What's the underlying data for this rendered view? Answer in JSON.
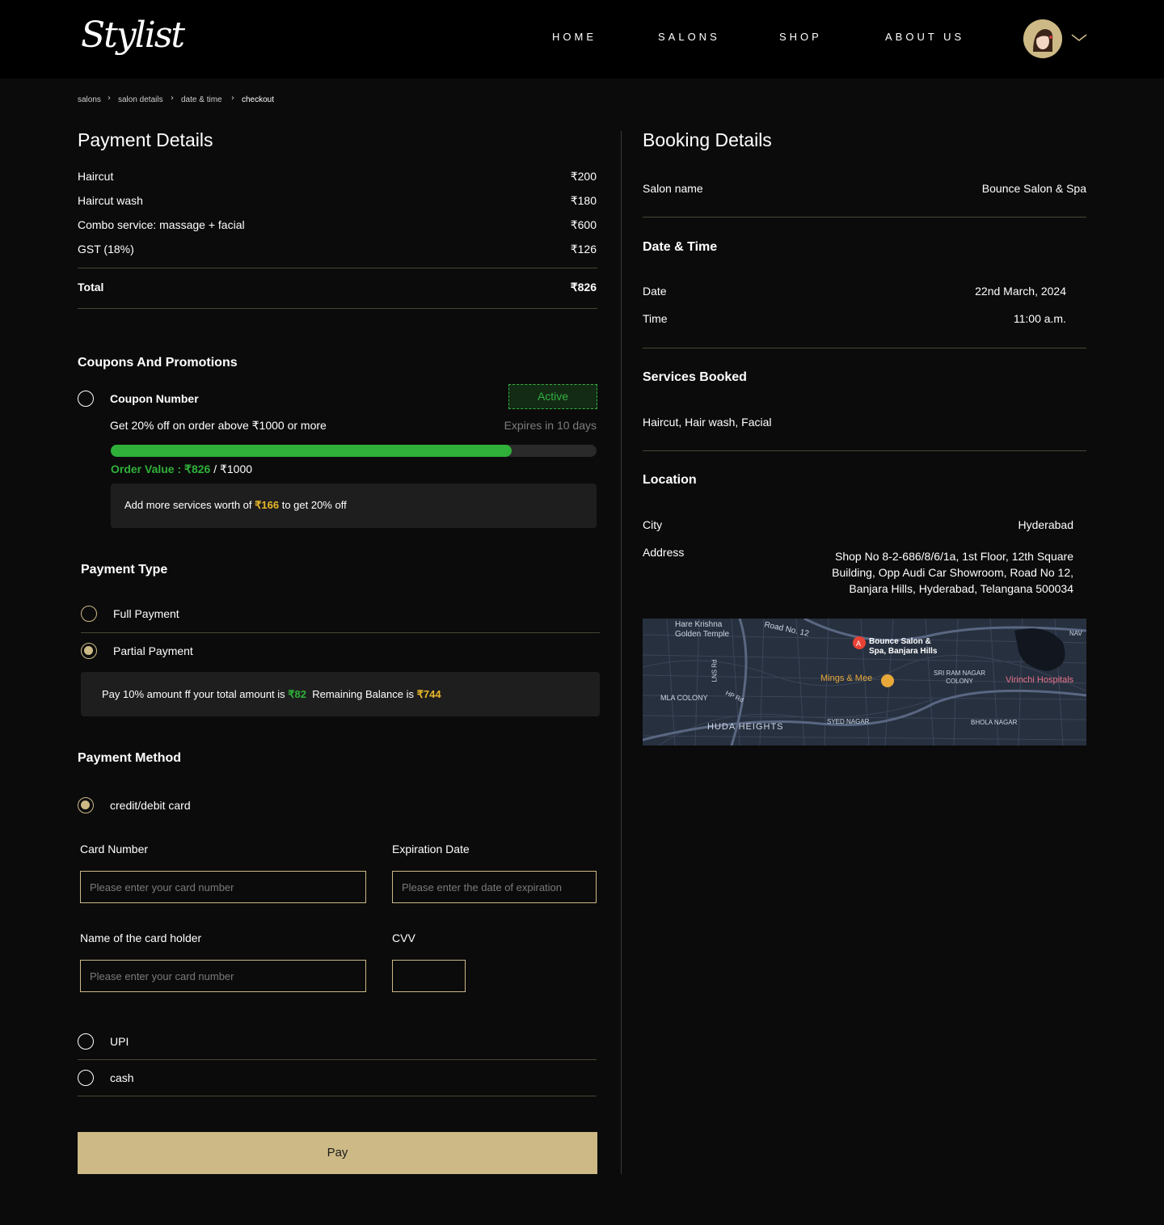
{
  "header": {
    "logo_text": "Stylist",
    "nav": [
      "HOME",
      "SALONS",
      "SHOP",
      "ABOUT US"
    ]
  },
  "breadcrumb": [
    "salons",
    "salon details",
    "date & time",
    "checkout"
  ],
  "payment": {
    "title": "Payment Details",
    "items": [
      {
        "label": "Haircut",
        "price": "₹200"
      },
      {
        "label": "Haircut wash",
        "price": "₹180"
      },
      {
        "label": "Combo service: massage + facial",
        "price": "₹600"
      },
      {
        "label": "GST (18%)",
        "price": "₹126"
      }
    ],
    "total_label": "Total",
    "total_value": "₹826"
  },
  "coupons": {
    "title": "Coupons And Promotions",
    "coupon_label": "Coupon Number",
    "status": "Active",
    "description": "Get 20% off on order above ₹1000 or more",
    "expiry": "Expires in 10 days",
    "progress": 0.826,
    "order_value_label": "Order Value : ₹826",
    "order_value_target": " / ₹1000",
    "hint_prefix": "Add more services worth of ",
    "hint_amount": "₹166",
    "hint_suffix": " to get 20% off"
  },
  "payment_type": {
    "title": "Payment Type",
    "full": "Full Payment",
    "partial": "Partial Payment",
    "note_prefix": "Pay 10% amount ff your total amount is ",
    "note_amount": "₹82",
    "note_mid": "  Remaining Balance is ",
    "note_balance": "₹744"
  },
  "payment_method": {
    "title": "Payment Method",
    "card_option": "credit/debit card",
    "card_number_label": "Card Number",
    "card_number_placeholder": "Please enter your card number",
    "expiry_label": "Expiration Date",
    "expiry_placeholder": "Please enter the date of expiration",
    "holder_label": "Name of the card holder",
    "holder_placeholder": "Please enter your card number",
    "cvv_label": "CVV",
    "upi": "UPI",
    "cash": "cash",
    "pay_label": "Pay"
  },
  "booking": {
    "title": "Booking Details",
    "salon_label": "Salon name",
    "salon_value": "Bounce Salon & Spa",
    "datetime_title": "Date & Time",
    "date_label": "Date",
    "date_value": "22nd March, 2024",
    "time_label": "Time",
    "time_value": "11:00 a.m.",
    "services_title": "Services Booked",
    "services_value": "Haircut, Hair wash, Facial",
    "location_title": "Location",
    "city_label": "City",
    "city_value": "Hyderabad",
    "address_label": "Address",
    "address_lines": [
      "Shop No 8-2-686/8/6/1a, 1st Floor, 12th Square",
      "Building, Opp Audi Car Showroom, Road No 12,",
      "Banjara Hills, Hyderabad, Telangana 500034"
    ]
  },
  "map": {
    "labels": {
      "temple": "Hare Krishna Golden Temple",
      "road12": "Road No. 12",
      "salon": "Bounce Salon & Spa, Banjara Hills",
      "mings": "Mings & Mee",
      "sriram": "SRI RAM NAGAR COLONY",
      "virinchi": "Virinchi Hospitals",
      "mla": "MLA COLONY",
      "huda": "HUDA HEIGHTS",
      "syed": "SYED NAGAR",
      "bhola": "BHOLA NAGAR",
      "lns": "LNS Rd",
      "hp": "HP Rd",
      "nav": "NAV"
    }
  },
  "colors": {
    "accent": "#cdb986",
    "green": "#2fb039",
    "yellow": "#e8b82a",
    "background": "#0b0b0b"
  }
}
